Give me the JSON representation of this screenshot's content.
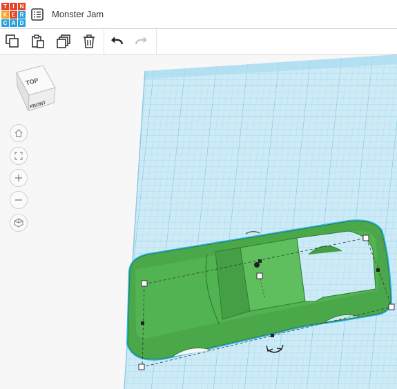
{
  "app": {
    "logo_letters": [
      "T",
      "I",
      "N",
      "K",
      "E",
      "R",
      "C",
      "A",
      "D"
    ],
    "logo_colors": [
      "#e5432a",
      "#e5432a",
      "#e5432a",
      "#f5a623",
      "#e5432a",
      "#2aa3dc",
      "#2aa3dc",
      "#2aa3dc",
      "#2aa3dc"
    ],
    "design_title": "Monster Jam"
  },
  "toolbar": {
    "buttons": [
      "copy-icon",
      "paste-icon",
      "duplicate-icon",
      "delete-icon",
      "undo-icon",
      "redo-icon"
    ]
  },
  "viewcube": {
    "top_label": "TOP",
    "front_label": "FRONT"
  },
  "nav_controls": [
    "home-icon",
    "fit-view-icon",
    "zoom-in-icon",
    "zoom-out-icon",
    "perspective-icon"
  ],
  "colors": {
    "shape_green": "#4caf50",
    "selection_cyan": "#29b6f6",
    "grid_blue": "#bfe3f3"
  }
}
